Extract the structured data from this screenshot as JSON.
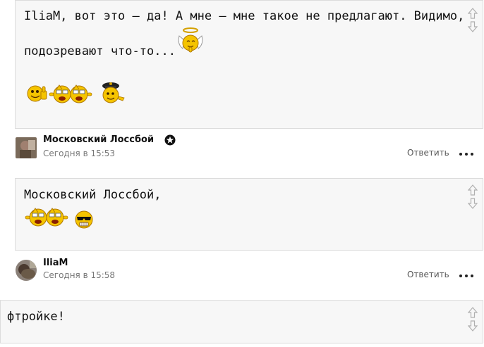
{
  "posts": [
    {
      "text_line1": "IliaM, вот это — да! А мне — мне такое не предлагают. Видимо,",
      "text_line2": "подозревают что-то..."
    },
    {
      "text_line1": "Московский Лоссбой,"
    },
    {
      "text_line1": "фтройке!"
    }
  ],
  "authors": [
    {
      "name": "Московский Лоссбой",
      "time": "Сегодня в 15:53",
      "reply_label": "Ответить"
    },
    {
      "name": "IliaM",
      "time": "Сегодня в 15:58",
      "reply_label": "Ответить"
    }
  ],
  "colors": {
    "post_bg": "#f7f7f7",
    "border": "#dcdcdc",
    "smiley_yellow": "#f5c400",
    "smiley_outline": "#b07800"
  },
  "icons": [
    "vote-up-icon",
    "vote-down-icon",
    "more-icon",
    "star-badge-icon",
    "smiley-icon"
  ]
}
